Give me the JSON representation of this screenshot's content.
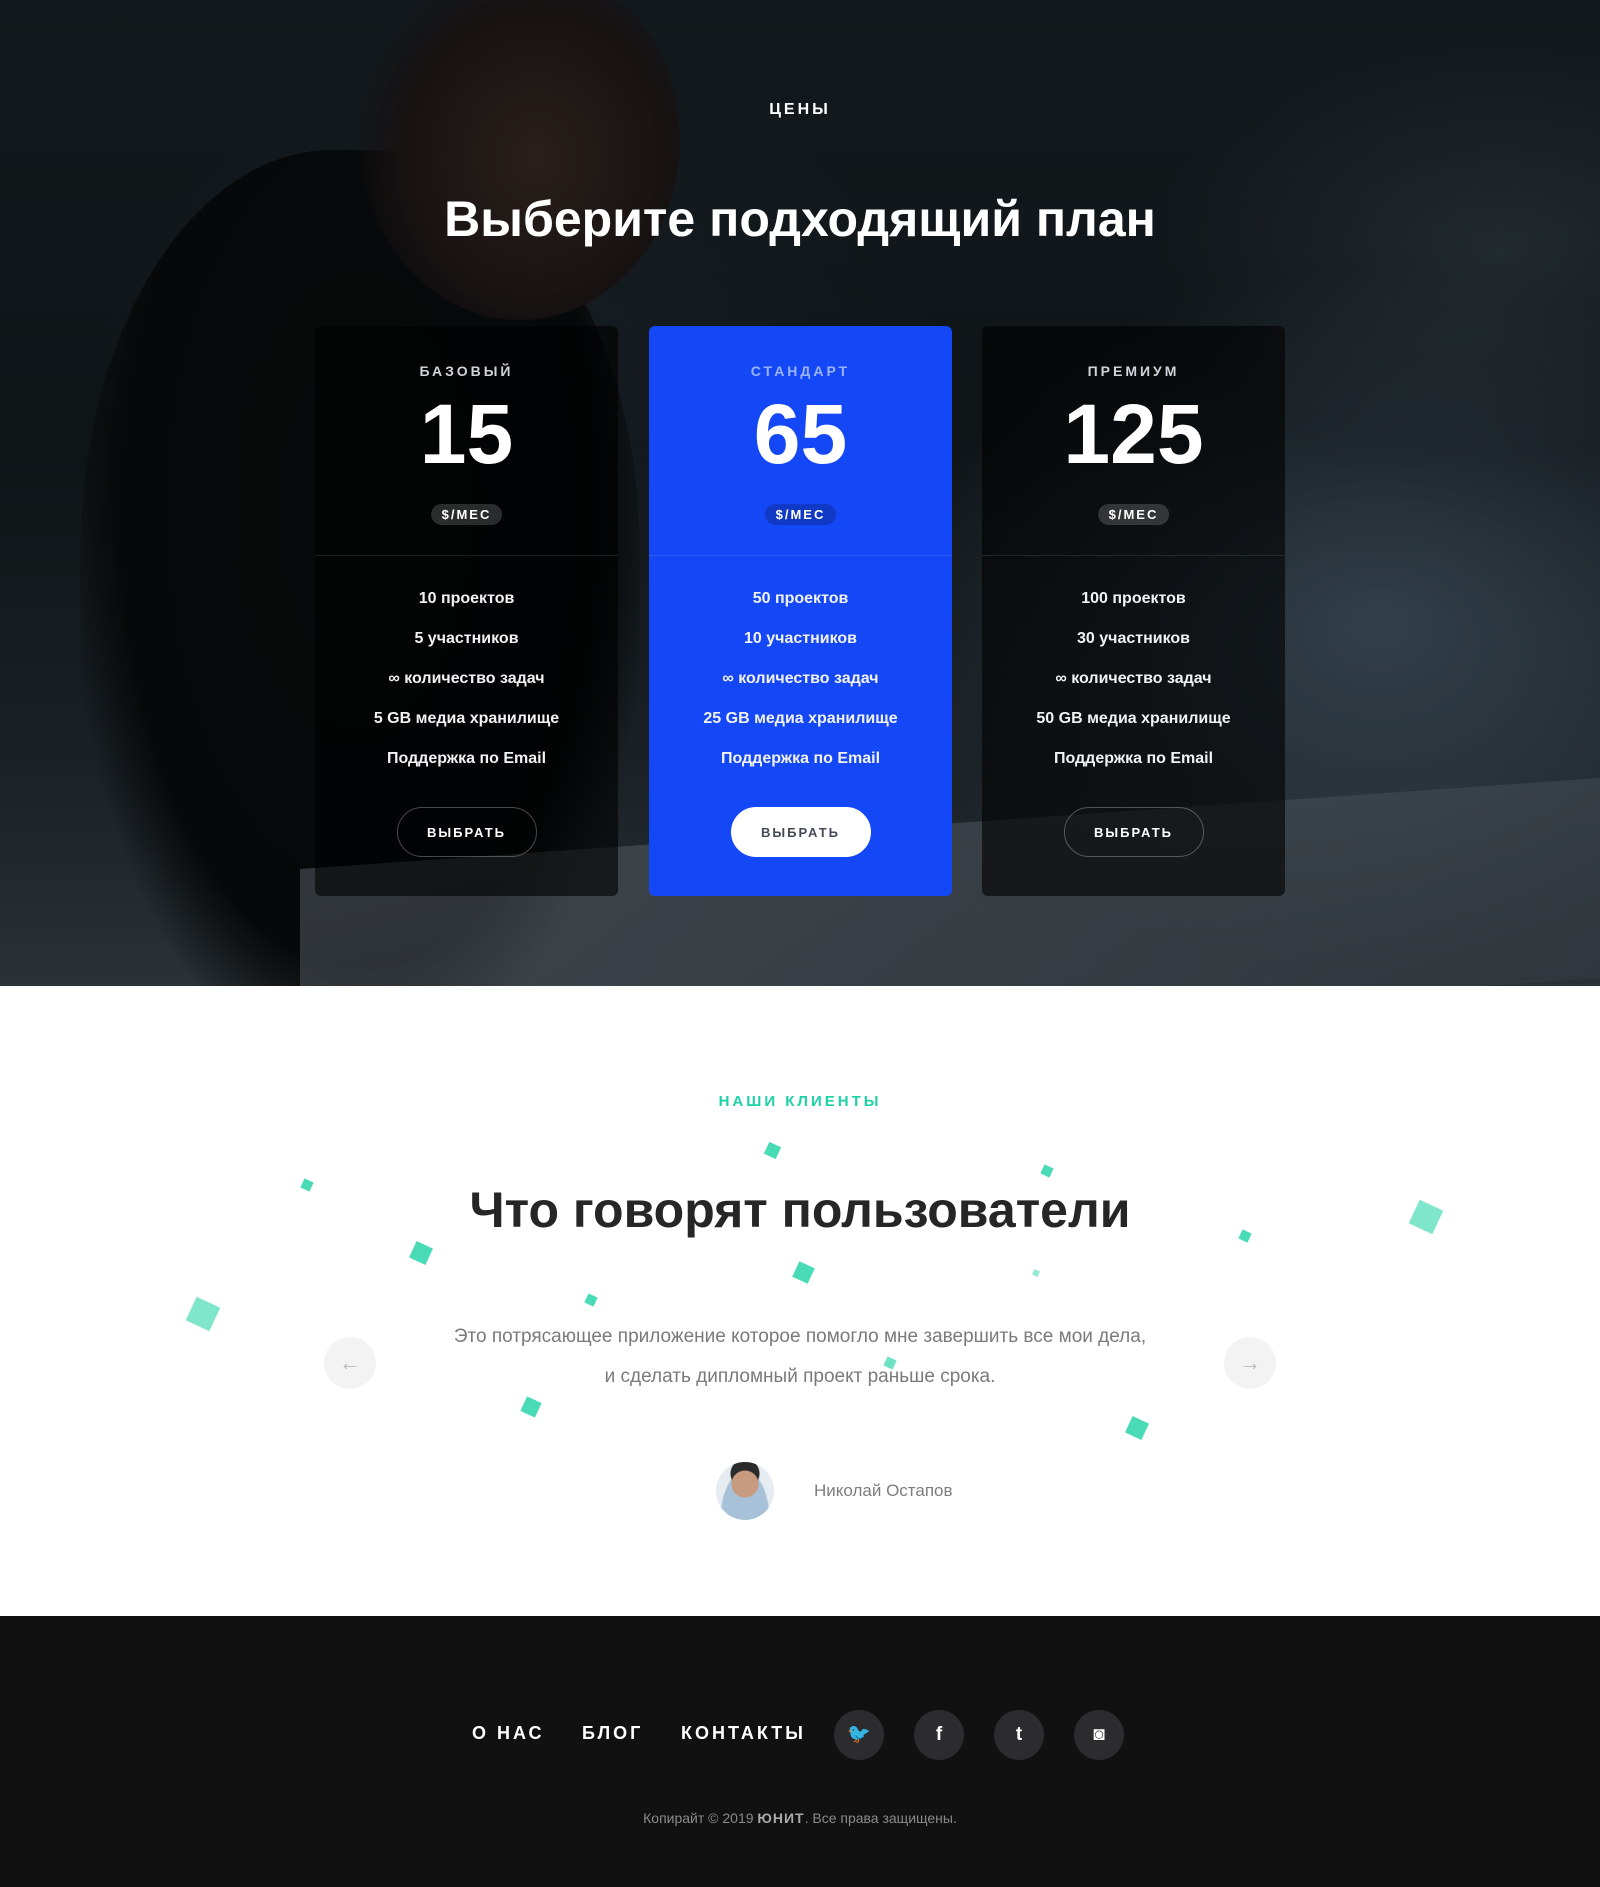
{
  "pricing": {
    "kicker": "ЦЕНЫ",
    "title": "Выберите подходящий план",
    "plans": [
      {
        "name": "БАЗОВЫЙ",
        "price": "15",
        "unit": "$/МЕС",
        "features": [
          "10 проектов",
          "5 участников",
          "∞ количество задач",
          "5 GB медиа хранилище",
          "Поддержка по Email"
        ],
        "button": "ВЫБРАТЬ"
      },
      {
        "name": "СТАНДАРТ",
        "price": "65",
        "unit": "$/МЕС",
        "features": [
          "50 проектов",
          "10 участников",
          "∞ количество задач",
          "25 GB медиа хранилище",
          "Поддержка по Email"
        ],
        "button": "ВЫБРАТЬ"
      },
      {
        "name": "ПРЕМИУМ",
        "price": "125",
        "unit": "$/МЕС",
        "features": [
          "100 проектов",
          "30 участников",
          "∞ количество задач",
          "50 GB медиа хранилище",
          "Поддержка по Email"
        ],
        "button": "ВЫБРАТЬ"
      }
    ],
    "colors": {
      "featured": "#1448f7"
    }
  },
  "testimonials": {
    "kicker": "НАШИ КЛИЕНТЫ",
    "title": "Что говорят пользователи",
    "quote_line1": "Это потрясающее приложение которое помогло мне завершить все мои дела,",
    "quote_line2": "и сделать дипломный проект раньше срока.",
    "author": "Николай Остапов",
    "prev_icon": "←",
    "next_icon": "→",
    "colors": {
      "accent": "#1fd1a7"
    }
  },
  "footer": {
    "links": [
      "О НАС",
      "БЛОГ",
      "КОНТАКТЫ"
    ],
    "social": [
      {
        "name": "twitter-icon",
        "glyph": "🐦"
      },
      {
        "name": "facebook-icon",
        "glyph": "f"
      },
      {
        "name": "tumblr-icon",
        "glyph": "t"
      },
      {
        "name": "instagram-icon",
        "glyph": "◙"
      }
    ],
    "copyright_prefix": "Копирайт © 2019 ",
    "brand": "ЮНИТ",
    "copyright_suffix": ". Все права защищены."
  }
}
